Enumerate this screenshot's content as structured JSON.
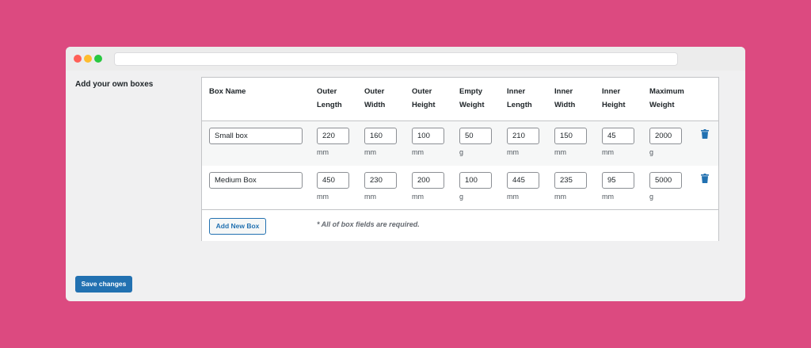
{
  "window": {
    "colors": {
      "close": "#ff5f57",
      "minimize": "#febc2e",
      "zoom": "#28c840"
    },
    "url": ""
  },
  "section": {
    "label": "Add your own boxes"
  },
  "table": {
    "headers": [
      [
        "Box Name",
        ""
      ],
      [
        "Outer",
        "Length"
      ],
      [
        "Outer",
        "Width"
      ],
      [
        "Outer",
        "Height"
      ],
      [
        "Empty",
        "Weight"
      ],
      [
        "Inner",
        "Length"
      ],
      [
        "Inner",
        "Width"
      ],
      [
        "Inner",
        "Height"
      ],
      [
        "Maximum",
        "Weight"
      ]
    ],
    "rows": [
      {
        "name": "Small box",
        "values": [
          "220",
          "160",
          "100",
          "50",
          "210",
          "150",
          "45",
          "2000"
        ],
        "units": [
          "mm",
          "mm",
          "mm",
          "g",
          "mm",
          "mm",
          "mm",
          "g"
        ],
        "delete_icon": "trash-icon"
      },
      {
        "name": "Medium Box",
        "values": [
          "450",
          "230",
          "200",
          "100",
          "445",
          "235",
          "95",
          "5000"
        ],
        "units": [
          "mm",
          "mm",
          "mm",
          "g",
          "mm",
          "mm",
          "mm",
          "g"
        ],
        "delete_icon": "trash-icon"
      }
    ],
    "add_button": "Add New Box",
    "required_note": "* All of box fields are required."
  },
  "save_button": "Save changes",
  "colors": {
    "accent": "#2271b1",
    "background": "#dc4a80"
  }
}
